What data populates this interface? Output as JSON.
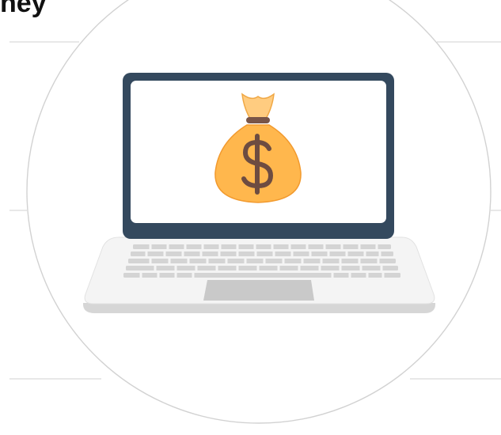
{
  "heading": {
    "visible_text": "ney"
  },
  "colors": {
    "background": "#ffffff",
    "circle_stroke": "#d2d2d2",
    "guide_lines": "#d9d9d9",
    "laptop_bezel": "#34495e",
    "laptop_screen": "#ffffff",
    "laptop_base": "#f4f4f4",
    "laptop_base_edge": "#d6d6d6",
    "keyboard_keys": "#d4d4d4",
    "trackpad": "#c9c9c9",
    "money_bag_fill": "#ffb74d",
    "money_bag_neck": "#ffcc80",
    "money_bag_tie": "#795548",
    "dollar_sign": "#6d4c41"
  },
  "icons": {
    "laptop": "laptop-icon",
    "money_bag": "money-bag-icon"
  }
}
